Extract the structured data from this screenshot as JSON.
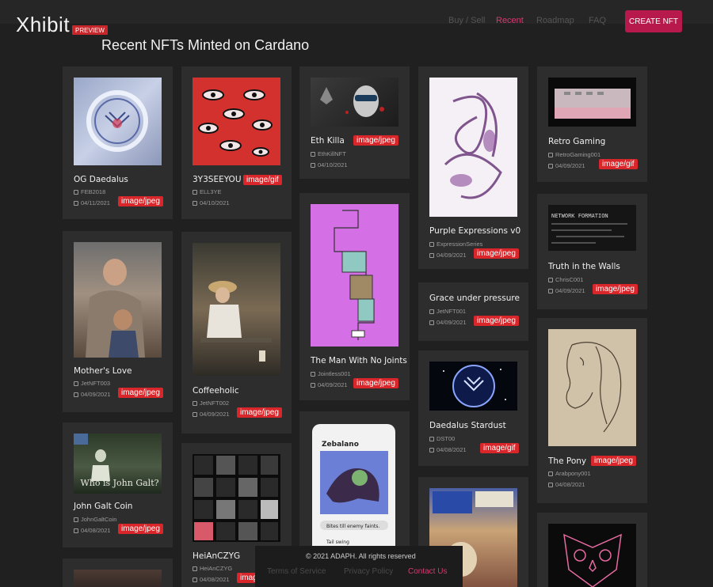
{
  "header": {
    "logo": "Xhibit",
    "badge": "PREVIEW",
    "nav": [
      "Buy / Sell",
      "Recent",
      "Roadmap",
      "FAQ"
    ],
    "create_button": "CREATE NFT"
  },
  "page_title": "Recent NFTs Minted on Cardano",
  "cards": [
    {
      "title": "OG Daedalus",
      "policy": "FEB2018",
      "date": "04/11/2021",
      "mime": "image/jpeg"
    },
    {
      "title": "Mother's Love",
      "policy": "JetNFT003",
      "date": "04/09/2021",
      "mime": "image/jpeg"
    },
    {
      "title": "John Galt Coin",
      "policy": "JohnGaltCoin",
      "date": "04/08/2021",
      "mime": "image/jpeg"
    },
    {
      "title": "3Y3SEEYOU",
      "policy": "ELL3YE",
      "date": "04/10/2021",
      "mime": "image/gif"
    },
    {
      "title": "Coffeeholic",
      "policy": "JetNFT002",
      "date": "04/09/2021",
      "mime": "image/jpeg"
    },
    {
      "title": "HeiAnCZYG",
      "policy": "HeiAnCZYG",
      "date": "04/08/2021",
      "mime": "image/jpeg"
    },
    {
      "title": "Eth Killa",
      "policy": "EthKillNFT",
      "date": "04/10/2021",
      "mime": "image/jpeg"
    },
    {
      "title": "The Man With No Joints",
      "policy": "Jointless001",
      "date": "04/09/2021",
      "mime": "image/jpeg"
    },
    {
      "title": "Purple Expressions v0",
      "policy": "ExpressionSeries",
      "date": "04/09/2021",
      "mime": "image/jpeg"
    },
    {
      "title": "Grace under pressure",
      "policy": "JetNFT001",
      "date": "04/09/2021",
      "mime": "image/jpeg"
    },
    {
      "title": "Daedalus Stardust",
      "policy": "DST00",
      "date": "04/08/2021",
      "mime": "image/gif"
    },
    {
      "title": "Retro Gaming",
      "policy": "RetroGaming001",
      "date": "04/09/2021",
      "mime": "image/gif"
    },
    {
      "title": "Truth in the Walls",
      "policy": "ChrisC001",
      "date": "04/09/2021",
      "mime": "image/jpeg"
    },
    {
      "title": "The Pony",
      "policy": "Arabpony001",
      "date": "04/08/2021",
      "mime": "image/jpeg"
    }
  ],
  "art_text": {
    "galt": "Who is John Galt?",
    "walls": "NETWORK FORMATION",
    "zebalano_title": "Zebalano",
    "zebalano_line1": "Bites till enemy faints.",
    "zebalano_line2": "Tail swing"
  },
  "footer": {
    "copyright": "© 2021 ADAPH. All rights reserved",
    "terms": "Terms of Service",
    "privacy": "Privacy Policy",
    "contact": "Contact Us"
  },
  "colors": {
    "background": "#202020",
    "card": "#2d2d2d",
    "mime_badge": "#d8262a",
    "accent": "#d03b70",
    "create_button": "#b8194c"
  }
}
